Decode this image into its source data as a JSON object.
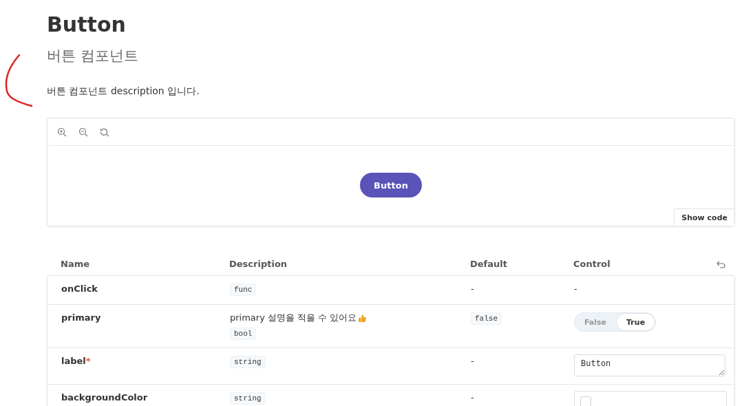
{
  "page": {
    "title": "Button",
    "subtitle": "버튼 컴포넌트",
    "description": "버튼 컴포넌트 description 입니다."
  },
  "preview": {
    "button_label": "Button",
    "show_code": "Show code"
  },
  "table": {
    "columns": [
      "Name",
      "Description",
      "Default",
      "Control"
    ],
    "rows": [
      {
        "name": "onClick",
        "type": "func",
        "default": {
          "kind": "plain",
          "text": "-"
        },
        "control": {
          "kind": "none",
          "text": "-"
        }
      },
      {
        "name": "primary",
        "description": "primary 설명을 적을 수 있어요",
        "type": "bool",
        "default": {
          "kind": "code",
          "text": "false"
        },
        "control": {
          "kind": "toggle",
          "options": [
            {
              "label": "False",
              "selected": false
            },
            {
              "label": "True",
              "selected": true
            }
          ]
        }
      },
      {
        "name": "label",
        "required_mark": "*",
        "type": "string",
        "default": {
          "kind": "plain",
          "text": "-"
        },
        "control": {
          "kind": "text",
          "value": "Button"
        }
      },
      {
        "name": "backgroundColor",
        "type": "string",
        "default": {
          "kind": "plain",
          "text": "-"
        },
        "control": {
          "kind": "color"
        }
      }
    ]
  }
}
